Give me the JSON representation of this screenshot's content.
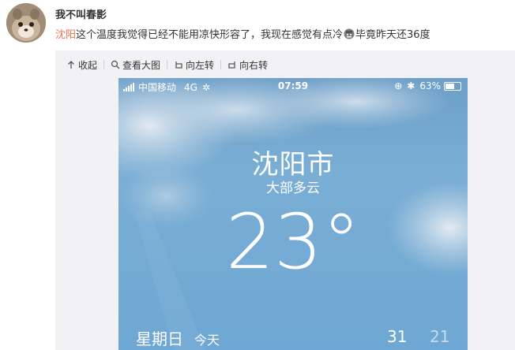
{
  "post": {
    "author": "我不叫春影",
    "mention": "沈阳",
    "text_main": "这个温度我觉得已经不能用凉快形容了，我现在感觉有点冷",
    "text_tail": "毕竟昨天还36度"
  },
  "toolbar": {
    "collapse_label": "收起",
    "view_large_label": "查看大图",
    "rotate_left_label": "向左转",
    "rotate_right_label": "向右转"
  },
  "phone": {
    "carrier": "中国移动",
    "network": "4G",
    "time": "07:59",
    "battery": "63%",
    "battery_level": 0.63,
    "city": "沈阳市",
    "condition": "大部多云",
    "temperature": "23°",
    "day_name": "星期日",
    "day_label": "今天",
    "high": "31",
    "low": "21"
  },
  "colors": {
    "mention": "#eb7350",
    "sky": "#6ea7d3"
  }
}
